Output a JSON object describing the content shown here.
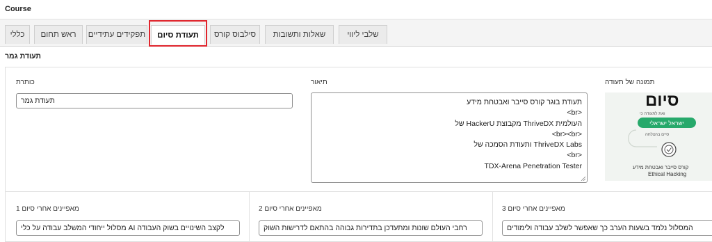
{
  "header": {
    "title": "Course"
  },
  "tabs": [
    {
      "label": "כללי"
    },
    {
      "label": "ראש תחום"
    },
    {
      "label": "תפקידים עתידיים"
    },
    {
      "label": "תעודת סיום"
    },
    {
      "label": "סילבוס קורס"
    },
    {
      "label": "שאלות ותשובות"
    },
    {
      "label": "שלבי ליווי"
    }
  ],
  "active_tab": "תעודת סיום",
  "section": {
    "title": "תעודת גמר"
  },
  "fields": {
    "title": {
      "label": "כותרת",
      "value": "תעודת גמר"
    },
    "description": {
      "label": "תיאור",
      "lines": [
        "תעודת בוגר קורס סייבר ואבטחת מידע",
        "<br>",
        "העולמית ThriveDX מקבוצת HackerU של",
        "<br><br>",
        "ThriveDX Labs ותעודת הסמכה של",
        "<br>",
        "TDX-Arena Penetration Tester"
      ]
    },
    "image": {
      "label": "תמונה של תעודה",
      "big_text": "סיום",
      "small1": "ואת לתעודה כי",
      "pill": "ישראל ישראלי",
      "small2": "סיים בהצלחה",
      "line1": "קורס סייבר ואבטחת מידע",
      "line2": "Ethical Hacking"
    },
    "feature1": {
      "label": "מאפיינים אחרי סיום 1",
      "value": "לקצב השינויים בשוק העבודה AI מסלול ייחודי המשלב עבודה על כלי"
    },
    "feature2": {
      "label": "מאפיינים אחרי סיום 2",
      "value": "רחבי העולם שונות ומתעדכן בתדירות גבוהה בהתאם לדרישות השוק"
    },
    "feature3": {
      "label": "מאפיינים אחרי סיום 3",
      "value": "המסלול נלמד בשעות הערב כך שאפשר לשלב עבודה ולימודים"
    }
  },
  "colors": {
    "highlight": "#e0242c",
    "pill": "#27a96b"
  }
}
